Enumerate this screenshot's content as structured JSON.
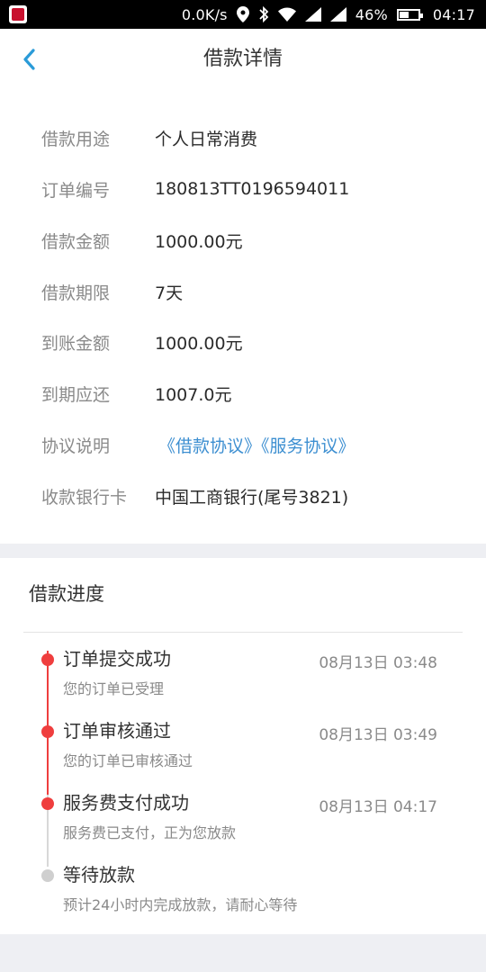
{
  "status_bar": {
    "network_speed": "0.0K/s",
    "battery": "46%",
    "time": "04:17",
    "icons": [
      "app-icon",
      "location-icon",
      "bluetooth-icon",
      "wifi-icon",
      "signal-icon",
      "signal-icon",
      "battery-icon"
    ]
  },
  "nav": {
    "title": "借款详情",
    "back_icon": "chevron-left-icon",
    "accent_color": "#2a9bd8"
  },
  "details": {
    "rows": [
      {
        "label": "借款用途",
        "value": "个人日常消费"
      },
      {
        "label": "订单编号",
        "value": "180813TT0196594011"
      },
      {
        "label": "借款金额",
        "value": "1000.00元"
      },
      {
        "label": "借款期限",
        "value": "7天"
      },
      {
        "label": "到账金额",
        "value": "1000.00元"
      },
      {
        "label": "到期应还",
        "value": "1007.0元"
      },
      {
        "label": "协议说明",
        "links": [
          "《借款协议》",
          "《服务协议》"
        ]
      },
      {
        "label": "收款银行卡",
        "value": "中国工商银行(尾号3821)"
      }
    ],
    "link_color": "#3d8fd1"
  },
  "progress": {
    "title": "借款进度",
    "steps": [
      {
        "title": "订单提交成功",
        "time": "08月13日 03:48",
        "desc": "您的订单已受理",
        "done": true
      },
      {
        "title": "订单审核通过",
        "time": "08月13日 03:49",
        "desc": "您的订单已审核通过",
        "done": true
      },
      {
        "title": "服务费支付成功",
        "time": "08月13日 04:17",
        "desc": "服务费已支付，正为您放款",
        "done": true
      },
      {
        "title": "等待放款",
        "time": "",
        "desc": "预计24小时内完成放款，请耐心等待",
        "done": false
      }
    ],
    "done_color": "#ef3e3e",
    "pending_color": "#cfcfcf"
  }
}
